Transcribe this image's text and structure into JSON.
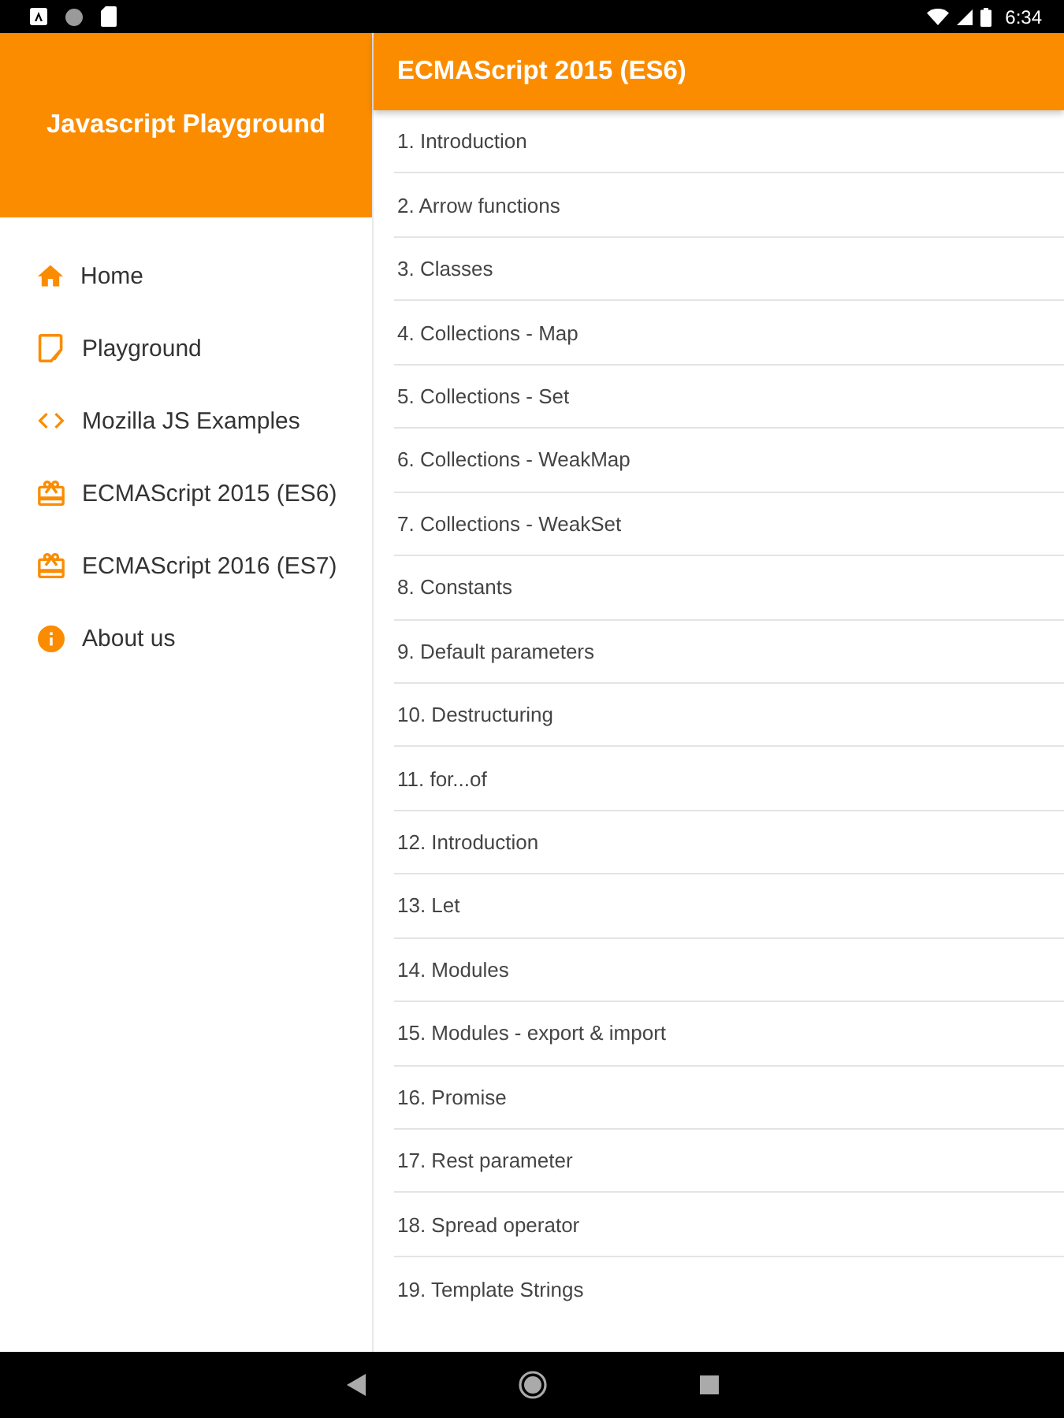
{
  "status_bar": {
    "time": "6:34"
  },
  "drawer": {
    "title": "Javascript Playground",
    "items": [
      {
        "kind": "home",
        "label": "Home"
      },
      {
        "kind": "note",
        "label": "Playground"
      },
      {
        "kind": "code",
        "label": "Mozilla JS Examples"
      },
      {
        "kind": "gift",
        "label": "ECMAScript 2015 (ES6)"
      },
      {
        "kind": "gift",
        "label": "ECMAScript 2016 (ES7)"
      },
      {
        "kind": "info",
        "label": "About us"
      }
    ]
  },
  "app_bar": {
    "title": "ECMAScript 2015 (ES6)"
  },
  "topics": [
    "1. Introduction",
    "2. Arrow functions",
    "3. Classes",
    "4. Collections - Map",
    "5. Collections - Set",
    "6. Collections - WeakMap",
    "7. Collections - WeakSet",
    "8. Constants",
    "9. Default parameters",
    "10. Destructuring",
    "11. for...of",
    "12. Introduction",
    "13. Let",
    "14. Modules",
    "15. Modules - export & import",
    "16. Promise",
    "17. Rest parameter",
    "18. Spread operator",
    "19. Template Strings"
  ]
}
